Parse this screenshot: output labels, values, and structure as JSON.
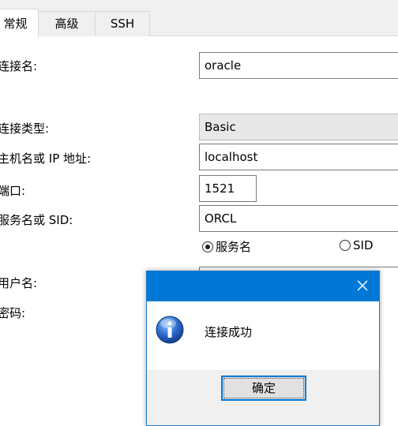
{
  "tabs": [
    {
      "label": "常规",
      "active": true
    },
    {
      "label": "高级",
      "active": false
    },
    {
      "label": "SSH",
      "active": false
    }
  ],
  "form": {
    "connection_name_label": "连接名:",
    "connection_name_value": "oracle",
    "connection_type_label": "连接类型:",
    "connection_type_value": "Basic",
    "host_label": "主机名或 IP 地址:",
    "host_value": "localhost",
    "port_label": "端口:",
    "port_value": "1521",
    "service_label": "服务名或 SID:",
    "service_value": "ORCL",
    "radio_service_name": "服务名",
    "radio_sid": "SID",
    "username_label": "用户名:",
    "password_label": "密码:"
  },
  "dialog": {
    "message": "连接成功",
    "ok_label": "确定",
    "title_bar_color": "#0078d7"
  },
  "icons": {
    "dialog_icon": "info-icon",
    "close": "close-icon"
  }
}
